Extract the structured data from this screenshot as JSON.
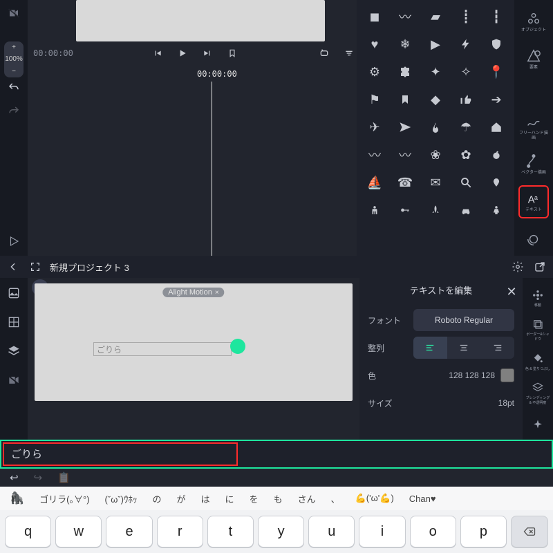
{
  "top": {
    "zoom_percent": "100%",
    "zoom_plus": "+",
    "zoom_minus": "−",
    "timecode": "00:00:00",
    "playhead_time": "00:00:00",
    "right_tools": [
      {
        "name": "オブジェクト"
      },
      {
        "name": "要素"
      },
      {
        "name": "フリーハンド描画"
      },
      {
        "name": "ベクター描画"
      },
      {
        "name": "テキスト"
      }
    ]
  },
  "shapes": {
    "rows": [
      [
        "sq",
        "sq",
        "sq",
        "sq",
        "sq"
      ],
      [
        "heart",
        "snow",
        "play",
        "bolt",
        "shield"
      ],
      [
        "gear",
        "puzzle",
        "star4",
        "sparkle",
        "pin"
      ],
      [
        "flag",
        "bookmark2",
        "diamond",
        "thumb",
        "arrow"
      ],
      [
        "plane",
        "send",
        "fire",
        "umbrella",
        "home"
      ],
      [
        "ribbon",
        "ribbon2",
        "wreath",
        "wreath2",
        "apple"
      ],
      [
        "sail",
        "phone",
        "mail",
        "search",
        "pin2"
      ],
      [
        "person",
        "key",
        "rocket",
        "car",
        "woman"
      ]
    ]
  },
  "bot": {
    "project_title": "新規プロジェクト 3",
    "watermark": "Alight Motion",
    "canvas_text": "ごりら",
    "panel_title": "テキストを編集",
    "labels": {
      "font": "フォント",
      "align": "整列",
      "color": "色",
      "size": "サイズ"
    },
    "font_name": "Roboto Regular",
    "color_value": "128 128 128",
    "size_value": "18pt",
    "right_tools": [
      {
        "name": "移動"
      },
      {
        "name": "ボーダー&シャドウ"
      },
      {
        "name": "色 & 塗りつぶし"
      },
      {
        "name": "ブレンディング & 不透明度"
      },
      {
        "name": "エフェクト"
      }
    ],
    "input_text": "ごりら"
  },
  "suggestions": [
    "🦍",
    "ゴリラ(｡∀°)",
    "(ˇωˇ)ｳﾎｯ",
    "の",
    "が",
    "は",
    "に",
    "を",
    "も",
    "さん",
    "、",
    "💪('ω'💪)",
    "Chan♥"
  ],
  "keys": [
    "q",
    "w",
    "e",
    "r",
    "t",
    "y",
    "u",
    "i",
    "o",
    "p"
  ]
}
